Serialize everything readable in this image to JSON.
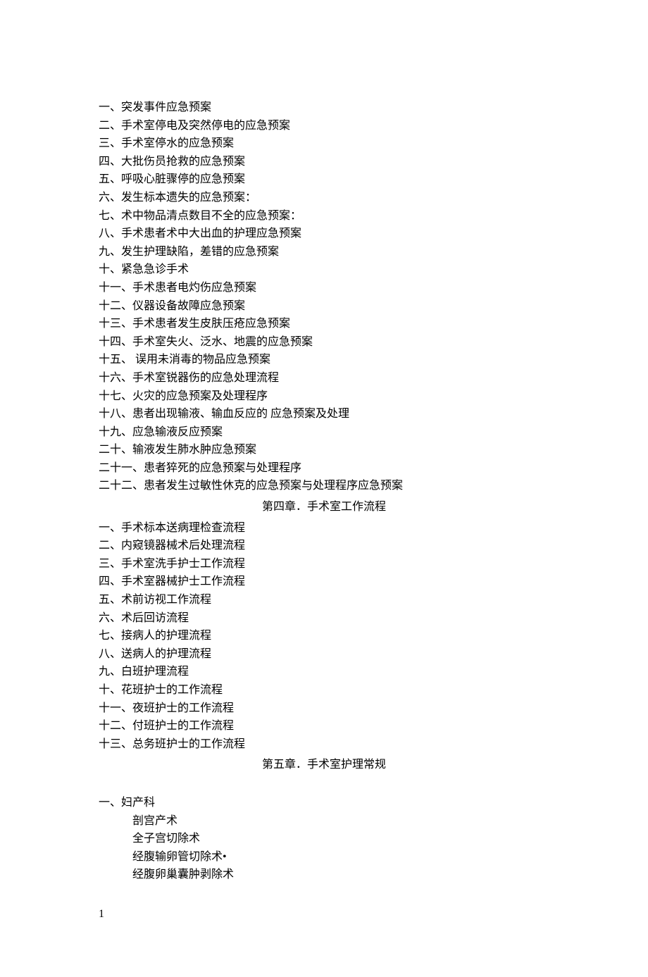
{
  "section1": {
    "items": [
      "一、突发事件应急预案",
      "二、手术室停电及突然停电的应急预案",
      "三、手术室停水的应急预案",
      "四、大批伤员抢救的应急预案",
      "五、呼吸心脏骤停的应急预案",
      "六、发生标本遗失的应急预案：",
      "七、术中物品清点数目不全的应急预案：",
      "八、手术患者术中大出血的护理应急预案",
      "九、发生护理缺陷，差错的应急预案",
      "十、紧急急诊手术",
      "十一、手术患者电灼伤应急预案",
      "十二、仪器设备故障应急预案",
      "十三、手术患者发生皮肤压疮应急预案",
      "十四、手术室失火、泛水、地震的应急预案",
      "十五、  误用未消毒的物品应急预案",
      "十六、手术室锐器伤的应急处理流程",
      "十七、火灾的应急预案及处理程序",
      "十八、患者出现输液、输血反应的  应急预案及处理",
      "十九、应急输液反应预案",
      "二十、输液发生肺水肿应急预案",
      "二十一、患者猝死的应急预案与处理程序",
      "二十二、患者发生过敏性休克的应急预案与处理程序应急预案"
    ]
  },
  "chapter4": {
    "title": "第四章．手术室工作流程",
    "items": [
      "一、手术标本送病理检查流程",
      "二、内窥镜器械术后处理流程",
      "三、手术室洗手护士工作流程",
      "四、手术室器械护士工作流程",
      "五、术前访视工作流程",
      "六、术后回访流程",
      "七、接病人的护理流程",
      "八、送病人的护理流程",
      "九、白班护理流程",
      "十、花班护士的工作流程",
      "十一、夜班护士的工作流程",
      "十二、付班护士的工作流程",
      "十三、总务班护士的工作流程"
    ]
  },
  "chapter5": {
    "title": "第五章．手术室护理常规",
    "sections": [
      {
        "heading": "一、妇产科",
        "subs": [
          "剖宫产术",
          "全子宫切除术",
          "经腹输卵管切除术•",
          "经腹卵巢囊肿剥除术"
        ]
      }
    ]
  },
  "footer": "1"
}
